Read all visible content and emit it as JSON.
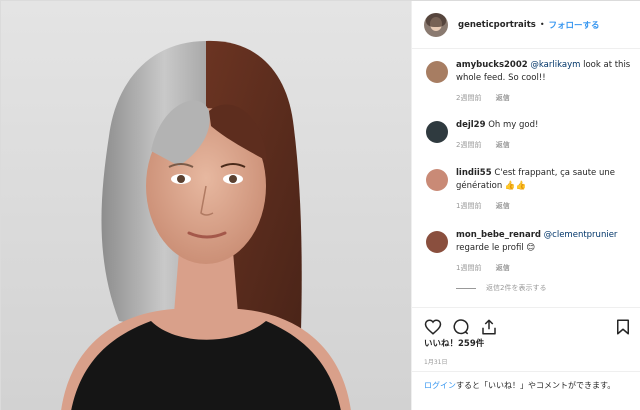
{
  "post": {
    "author": "geneticportraits",
    "dot": "•",
    "follow_label": "フォローする"
  },
  "comments": [
    {
      "author": "amybucks2002",
      "mention": "@karlikaym",
      "text": " look at this whole feed. So cool!!",
      "time": "2週間前",
      "reply": "返信"
    },
    {
      "author": "dejl29",
      "mention": "",
      "text": " Oh my god!",
      "time": "2週間前",
      "reply": "返信"
    },
    {
      "author": "lindii55",
      "mention": "",
      "text": " C'est frappant, ça saute une génération 👍👍",
      "time": "1週間前",
      "reply": "返信"
    },
    {
      "author": "mon_bebe_renard",
      "mention": "@clementprunier",
      "text": " regarde le profil 😊",
      "time": "1週間前",
      "reply": "返信"
    }
  ],
  "view_replies": "返信2件を表示する",
  "likes": "いいね！259件",
  "date": "1月31日",
  "login_prompt": {
    "link": "ログイン",
    "rest": "すると「いいね！」やコメントができます。"
  },
  "icons": [
    "heart-icon",
    "comment-icon",
    "share-icon",
    "bookmark-icon"
  ],
  "colors": {
    "accent": "#3897f0",
    "muted": "#999999",
    "border": "#efefef"
  }
}
